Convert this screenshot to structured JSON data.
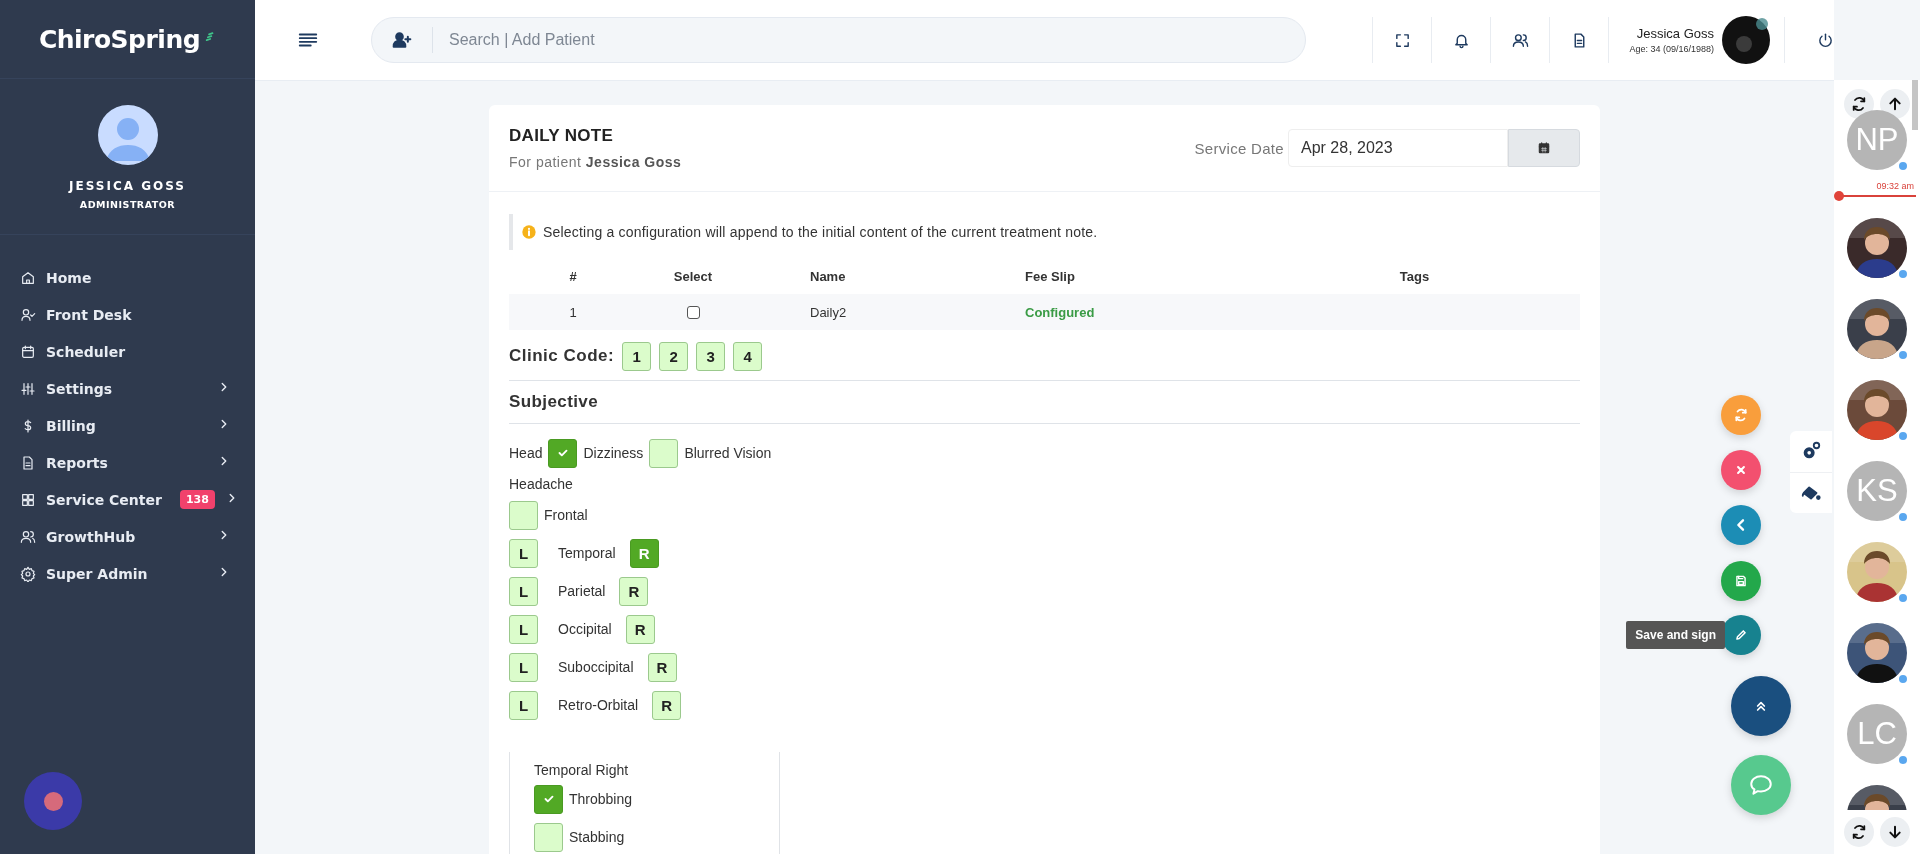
{
  "brand": "ChiroSpring",
  "sidebar": {
    "user": {
      "name": "JESSICA GOSS",
      "role": "ADMINISTRATOR"
    },
    "items": [
      {
        "label": "Home",
        "chevron": false
      },
      {
        "label": "Front Desk",
        "chevron": false
      },
      {
        "label": "Scheduler",
        "chevron": false
      },
      {
        "label": "Settings",
        "chevron": true
      },
      {
        "label": "Billing",
        "chevron": true
      },
      {
        "label": "Reports",
        "chevron": true
      },
      {
        "label": "Service Center",
        "chevron": true,
        "badge": "138"
      },
      {
        "label": "GrowthHub",
        "chevron": true
      },
      {
        "label": "Super Admin",
        "chevron": true
      }
    ]
  },
  "header": {
    "search": {
      "placeholder": "Search | Add Patient"
    },
    "user": {
      "name": "Jessica Goss",
      "age": "Age: 34 (09/16/1988)"
    }
  },
  "note": {
    "title": "DAILY NOTE",
    "subtitle": "For patient **Jessica Goss**",
    "service_date": {
      "label": "Service Date",
      "value": "Apr 28, 2023"
    },
    "info": "Selecting a configuration will append to the initial content of the current treatment note.",
    "table": {
      "columns": [
        "#",
        "Select",
        "Name",
        "Fee Slip",
        "Tags"
      ],
      "rows": [
        {
          "number": "1",
          "selected": false,
          "name": "Daily2",
          "fee_slip": "Configured"
        }
      ]
    },
    "clinic_code": {
      "label": "Clinic Code:",
      "codes": [
        "1",
        "2",
        "3",
        "4"
      ]
    },
    "section": "Subjective",
    "head": {
      "label": "Head",
      "options": [
        {
          "label": "Dizziness",
          "checked": true
        },
        {
          "label": "Blurred Vision",
          "checked": false
        }
      ]
    },
    "headache": {
      "label": "Headache",
      "frontal": {
        "label": "Frontal",
        "checked": false
      },
      "sides": [
        {
          "left": "L",
          "label": "Temporal",
          "right": "R",
          "left_checked": false,
          "right_checked": true
        },
        {
          "left": "L",
          "label": "Parietal",
          "right": "R",
          "left_checked": false,
          "right_checked": false
        },
        {
          "left": "L",
          "label": "Occipital",
          "right": "R",
          "left_checked": false,
          "right_checked": false
        },
        {
          "left": "L",
          "label": "Suboccipital",
          "right": "R",
          "left_checked": false,
          "right_checked": false
        },
        {
          "left": "L",
          "label": "Retro-Orbital",
          "right": "R",
          "left_checked": false,
          "right_checked": false
        }
      ]
    },
    "detail": {
      "title": "Temporal Right",
      "options": [
        {
          "label": "Throbbing",
          "checked": true
        },
        {
          "label": "Stabbing",
          "checked": false
        }
      ]
    }
  },
  "actions": [
    {
      "kind": "refresh"
    },
    {
      "kind": "close"
    },
    {
      "kind": "back"
    },
    {
      "kind": "save"
    },
    {
      "kind": "sign",
      "tooltip": "Save and sign"
    },
    {
      "kind": "up"
    },
    {
      "kind": "chat"
    }
  ],
  "rail": {
    "time": "09:32 am",
    "patients": [
      {
        "kind": "initials",
        "initials": "NP"
      },
      {
        "kind": "picture"
      },
      {
        "kind": "picture"
      },
      {
        "kind": "picture"
      },
      {
        "kind": "initials",
        "initials": "KS"
      },
      {
        "kind": "picture"
      },
      {
        "kind": "picture"
      },
      {
        "kind": "initials",
        "initials": "LC"
      },
      {
        "kind": "picture"
      }
    ]
  }
}
